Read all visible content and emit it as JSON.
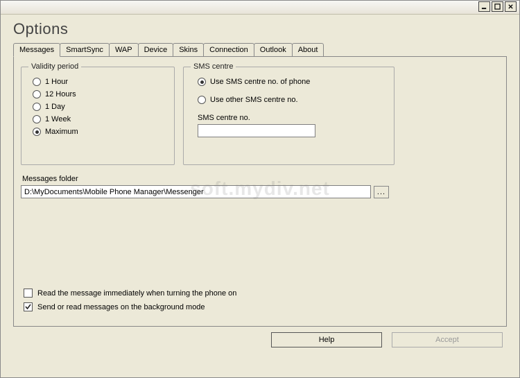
{
  "page_title": "Options",
  "tabs": [
    {
      "label": "Messages",
      "active": true
    },
    {
      "label": "SmartSync",
      "active": false
    },
    {
      "label": "WAP",
      "active": false
    },
    {
      "label": "Device",
      "active": false
    },
    {
      "label": "Skins",
      "active": false
    },
    {
      "label": "Connection",
      "active": false
    },
    {
      "label": "Outlook",
      "active": false
    },
    {
      "label": "About",
      "active": false
    }
  ],
  "validity": {
    "legend": "Validity period",
    "options": [
      {
        "label": "1 Hour",
        "selected": false
      },
      {
        "label": "12 Hours",
        "selected": false
      },
      {
        "label": "1 Day",
        "selected": false
      },
      {
        "label": "1 Week",
        "selected": false
      },
      {
        "label": "Maximum",
        "selected": true
      }
    ]
  },
  "sms_centre": {
    "legend": "SMS centre",
    "options": [
      {
        "label": "Use SMS centre no. of phone",
        "selected": true
      },
      {
        "label": "Use other SMS centre no.",
        "selected": false
      }
    ],
    "number_label": "SMS centre no.",
    "number_value": ""
  },
  "messages_folder": {
    "label": "Messages folder",
    "value": "D:\\MyDocuments\\Mobile Phone Manager\\Messenger",
    "browse_label": "..."
  },
  "checkboxes": [
    {
      "label": "Read the message immediately when turning the phone on",
      "checked": false
    },
    {
      "label": "Send or read messages on the background mode",
      "checked": true
    }
  ],
  "buttons": {
    "help": "Help",
    "accept": "Accept"
  },
  "watermark": "soft.mydiv.net"
}
